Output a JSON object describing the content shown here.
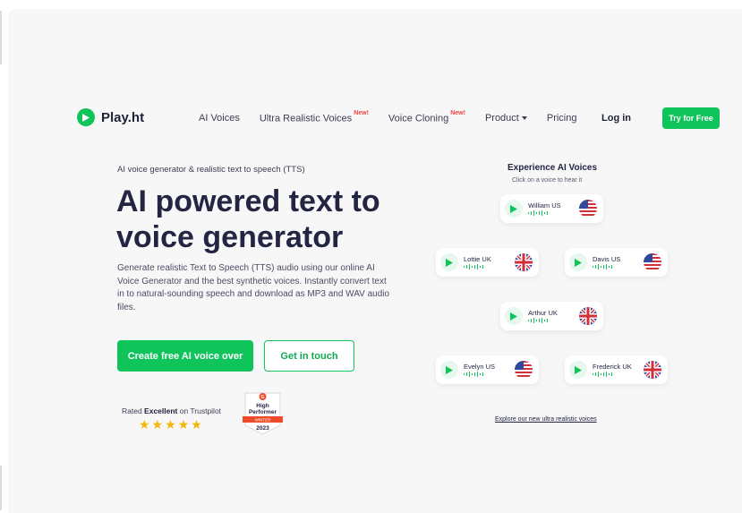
{
  "brand": {
    "name": "Play.ht",
    "accent": "#10c45c"
  },
  "nav": {
    "items": [
      {
        "label": "AI Voices",
        "badge": ""
      },
      {
        "label": "Ultra Realistic Voices",
        "badge": "New!"
      },
      {
        "label": "Voice Cloning",
        "badge": "New!"
      },
      {
        "label": "Product",
        "badge": ""
      },
      {
        "label": "Pricing",
        "badge": ""
      }
    ],
    "login": "Log in",
    "cta": "Try for Free"
  },
  "hero": {
    "eyebrow": "AI voice generator & realistic text to speech (TTS)",
    "headline": "AI powered text to voice generator",
    "description": "Generate realistic Text to Speech (TTS) audio using our online AI Voice Generator and the best synthetic voices. Instantly convert text in to natural-sounding speech and download as MP3 and WAV audio files.",
    "primary_cta": "Create free AI voice over",
    "secondary_cta": "Get in touch",
    "rating_prefix": "Rated ",
    "rating_word": "Excellent",
    "rating_suffix": " on Trustpilot",
    "stars": "★★★★★",
    "badge": {
      "line1": "High",
      "line2": "Performer",
      "season": "WINTER",
      "year": "2023"
    }
  },
  "voices_panel": {
    "title": "Experience AI Voices",
    "subtitle": "Click on a voice to hear it",
    "voices": [
      {
        "name": "William US",
        "flag": "us-flag-icon"
      },
      {
        "name": "Lottie UK",
        "flag": "uk-flag-icon"
      },
      {
        "name": "Davis US",
        "flag": "us-flag-icon"
      },
      {
        "name": "Arthur UK",
        "flag": "uk-flag-icon"
      },
      {
        "name": "Evelyn US",
        "flag": "us-flag-icon"
      },
      {
        "name": "Frederick UK",
        "flag": "uk-flag-icon"
      }
    ],
    "explore_link": "Explore our new ultra realistic voices"
  }
}
